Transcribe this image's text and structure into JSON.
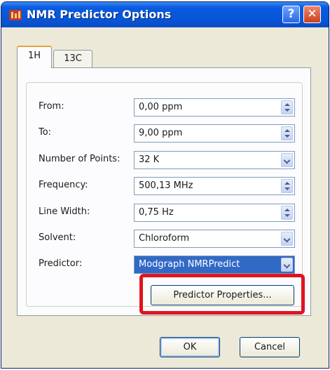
{
  "window": {
    "title": "NMR Predictor Options",
    "help_label": "?",
    "close_label": "✕",
    "accent_color": "#0655d8"
  },
  "tabs": [
    {
      "label": "1H",
      "active": true
    },
    {
      "label": "13C",
      "active": false
    }
  ],
  "form": {
    "from": {
      "label": "From:",
      "value": "0,00 ppm",
      "control": "spinner"
    },
    "to": {
      "label": "To:",
      "value": "9,00 ppm",
      "control": "spinner"
    },
    "points": {
      "label": "Number of Points:",
      "value": "32 K",
      "control": "dropdown"
    },
    "frequency": {
      "label": "Frequency:",
      "value": "500,13 MHz",
      "control": "spinner"
    },
    "line_width": {
      "label": "Line Width:",
      "value": "0,75 Hz",
      "control": "spinner"
    },
    "solvent": {
      "label": "Solvent:",
      "value": "Chloroform",
      "control": "dropdown"
    },
    "predictor": {
      "label": "Predictor:",
      "value": "Modgraph NMRPredict",
      "control": "dropdown",
      "selected": true
    }
  },
  "buttons": {
    "predictor_properties": "Predictor Properties...",
    "ok": "OK",
    "cancel": "Cancel"
  },
  "highlight_color": "#e0141e"
}
